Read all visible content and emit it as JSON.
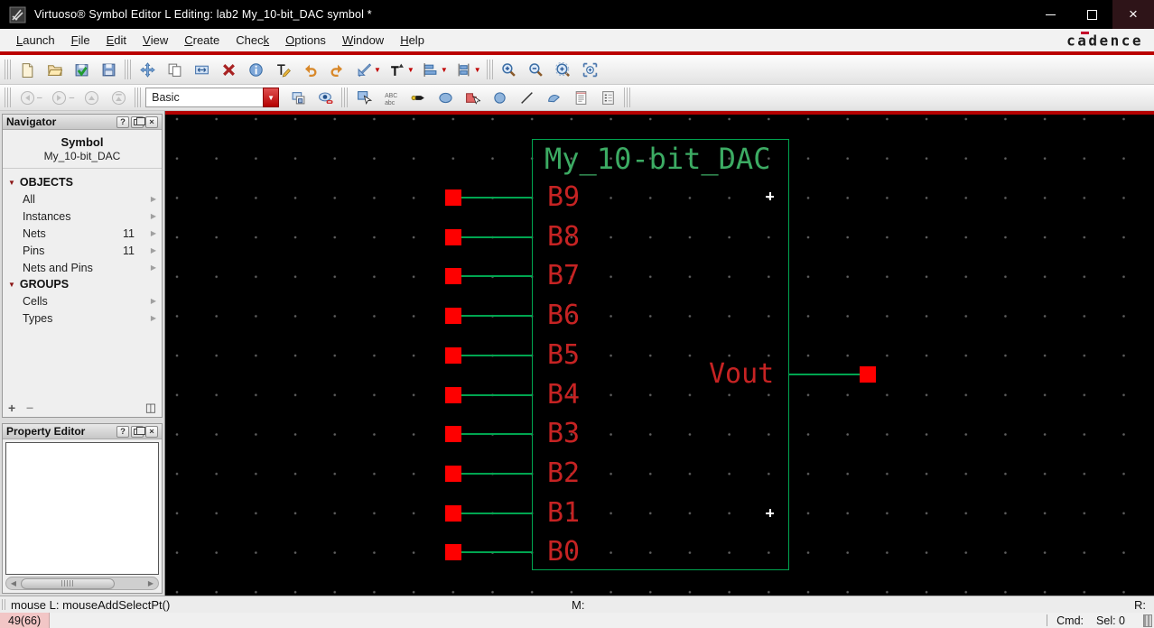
{
  "window": {
    "title": "Virtuoso® Symbol Editor L Editing: lab2 My_10-bit_DAC symbol *",
    "buttons": [
      {
        "name": "minimize-button",
        "glyph": ""
      },
      {
        "name": "maximize-button",
        "glyph": ""
      },
      {
        "name": "close-button",
        "glyph": "×"
      }
    ]
  },
  "menubar": {
    "items": [
      {
        "label": "Launch",
        "mnemonic": "L"
      },
      {
        "label": "File",
        "mnemonic": "F"
      },
      {
        "label": "Edit",
        "mnemonic": "E"
      },
      {
        "label": "View",
        "mnemonic": "V"
      },
      {
        "label": "Create",
        "mnemonic": "C"
      },
      {
        "label": "Check",
        "mnemonic": "k"
      },
      {
        "label": "Options",
        "mnemonic": "O"
      },
      {
        "label": "Window",
        "mnemonic": "W"
      },
      {
        "label": "Help",
        "mnemonic": "H"
      }
    ],
    "logo": "cadence"
  },
  "toolbars": {
    "row1": [
      {
        "type": "handle"
      },
      {
        "type": "btn",
        "name": "new-file"
      },
      {
        "type": "btn",
        "name": "open"
      },
      {
        "type": "btn",
        "name": "check-and-save"
      },
      {
        "type": "btn",
        "name": "save"
      },
      {
        "type": "handle"
      },
      {
        "type": "btn",
        "name": "move"
      },
      {
        "type": "btn",
        "name": "copy"
      },
      {
        "type": "btn",
        "name": "stretch"
      },
      {
        "type": "btn",
        "name": "delete"
      },
      {
        "type": "btn",
        "name": "properties"
      },
      {
        "type": "btn",
        "name": "edit-labels"
      },
      {
        "type": "btn",
        "name": "undo"
      },
      {
        "type": "btn",
        "name": "redo"
      },
      {
        "type": "btn",
        "name": "measure",
        "dropdown": true
      },
      {
        "type": "btn",
        "name": "create-label",
        "dropdown": true
      },
      {
        "type": "btn",
        "name": "align",
        "dropdown": true
      },
      {
        "type": "btn",
        "name": "distribute",
        "dropdown": true
      },
      {
        "type": "handle"
      },
      {
        "type": "btn",
        "name": "zoom-in"
      },
      {
        "type": "btn",
        "name": "zoom-out"
      },
      {
        "type": "btn",
        "name": "zoom-to-fit"
      },
      {
        "type": "btn",
        "name": "zoom-to-selected"
      }
    ],
    "row2": [
      {
        "type": "handle"
      },
      {
        "type": "btn",
        "name": "go-back",
        "disabled": true
      },
      {
        "type": "minicaret"
      },
      {
        "type": "btn",
        "name": "go-forward",
        "disabled": true
      },
      {
        "type": "minicaret"
      },
      {
        "type": "btn",
        "name": "go-up",
        "disabled": true
      },
      {
        "type": "btn",
        "name": "go-top",
        "disabled": true
      },
      {
        "type": "handle"
      },
      {
        "type": "combo",
        "name": "style-selector",
        "value": "Basic"
      },
      {
        "type": "btn",
        "name": "copy-view"
      },
      {
        "type": "btn",
        "name": "hide-object"
      },
      {
        "type": "handle"
      },
      {
        "type": "btn",
        "name": "select-tool"
      },
      {
        "type": "btn",
        "name": "label-tool"
      },
      {
        "type": "btn",
        "name": "pin-tool"
      },
      {
        "type": "btn",
        "name": "ellipse-tool"
      },
      {
        "type": "btn",
        "name": "edit-shape-tool"
      },
      {
        "type": "btn",
        "name": "circle-tool"
      },
      {
        "type": "btn",
        "name": "line-tool"
      },
      {
        "type": "btn",
        "name": "arc-tool"
      },
      {
        "type": "btn",
        "name": "note-tool"
      },
      {
        "type": "btn",
        "name": "doc-properties"
      },
      {
        "type": "handle"
      }
    ]
  },
  "navigator": {
    "title": "Navigator",
    "header_buttons": [
      {
        "name": "help",
        "glyph": "?"
      },
      {
        "name": "float",
        "glyph": ""
      },
      {
        "name": "close",
        "glyph": "×"
      }
    ],
    "view_type": "Symbol",
    "cell_name": "My_10-bit_DAC",
    "sections": [
      {
        "label": "OBJECTS",
        "items": [
          {
            "label": "All"
          },
          {
            "label": "Instances"
          },
          {
            "label": "Nets",
            "count": "11"
          },
          {
            "label": "Pins",
            "count": "11"
          },
          {
            "label": "Nets and Pins"
          }
        ]
      },
      {
        "label": "GROUPS",
        "items": [
          {
            "label": "Cells"
          },
          {
            "label": "Types"
          }
        ]
      }
    ],
    "footer": {
      "add": "+",
      "remove": "−",
      "columns": "◫"
    }
  },
  "property_editor": {
    "title": "Property Editor"
  },
  "canvas": {
    "symbol": {
      "title": "My_10-bit_DAC",
      "input_pins": [
        "B9",
        "B8",
        "B7",
        "B6",
        "B5",
        "B4",
        "B3",
        "B2",
        "B1",
        "B0"
      ],
      "output_pin": "Vout"
    },
    "colors": {
      "background": "#000000",
      "grid_dot": "#606060",
      "shape_green": "#00a550",
      "title_green": "#3cab63",
      "label_red": "#c62323",
      "pin_red": "#fe0000"
    }
  },
  "statusbar": {
    "prompt": "mouse L: mouseAddSelectPt()",
    "mouse_middle": "M:",
    "mouse_right": "R:"
  },
  "bottombar": {
    "counter": "49(66)",
    "cmd_label": "Cmd:",
    "sel_label": "Sel: 0"
  }
}
